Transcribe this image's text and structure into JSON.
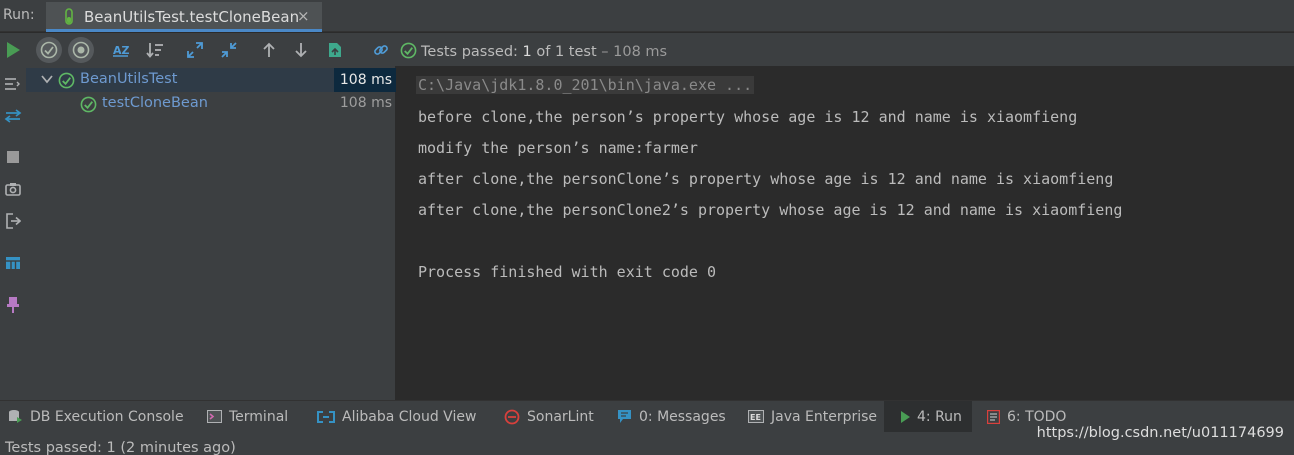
{
  "run_bar": {
    "label": "Run:",
    "tab_title": "BeanUtilsTest.testCloneBean",
    "close_glyph": "×"
  },
  "toolbar": {
    "status_prefix": "Tests passed: ",
    "status_count": "1",
    "status_mid": " of 1 test",
    "status_time": " – 108 ms"
  },
  "tree": {
    "items": [
      {
        "name": "BeanUtilsTest",
        "time": "108 ms",
        "selected": true
      },
      {
        "name": "testCloneBean",
        "time": "108 ms",
        "selected": false
      }
    ]
  },
  "console": {
    "lines": [
      "C:\\Java\\jdk1.8.0_201\\bin\\java.exe ...",
      "before clone,the person’s property whose age is 12 and name is xiaomfieng",
      "modify the person’s name:farmer",
      "after clone,the personClone’s property whose age is 12 and name is xiaomfieng",
      "after clone,the personClone2’s property whose age is 12 and name is xiaomfieng",
      "",
      "Process finished with exit code 0"
    ]
  },
  "bottom_tabs": [
    {
      "label": "DB Execution Console",
      "icon": "db-console-icon"
    },
    {
      "label": "Terminal",
      "icon": "terminal-icon"
    },
    {
      "label": "Alibaba Cloud View",
      "icon": "cloud-icon"
    },
    {
      "label": "SonarLint",
      "icon": "sonarlint-icon"
    },
    {
      "label": "0: Messages",
      "icon": "messages-icon"
    },
    {
      "label": "Java Enterprise",
      "icon": "java-enterprise-icon"
    },
    {
      "label": "4: Run",
      "icon": "run-icon"
    },
    {
      "label": "6: TODO",
      "icon": "todo-icon"
    }
  ],
  "status_bar": {
    "message": "Tests passed: 1 (2 minutes ago)",
    "watermark": "https://blog.csdn.net/u011174699"
  },
  "colors": {
    "pass_green": "#5fb865",
    "link_blue": "#6e9ad0",
    "background": "#2b2b2b",
    "panel": "#3c3f41"
  }
}
